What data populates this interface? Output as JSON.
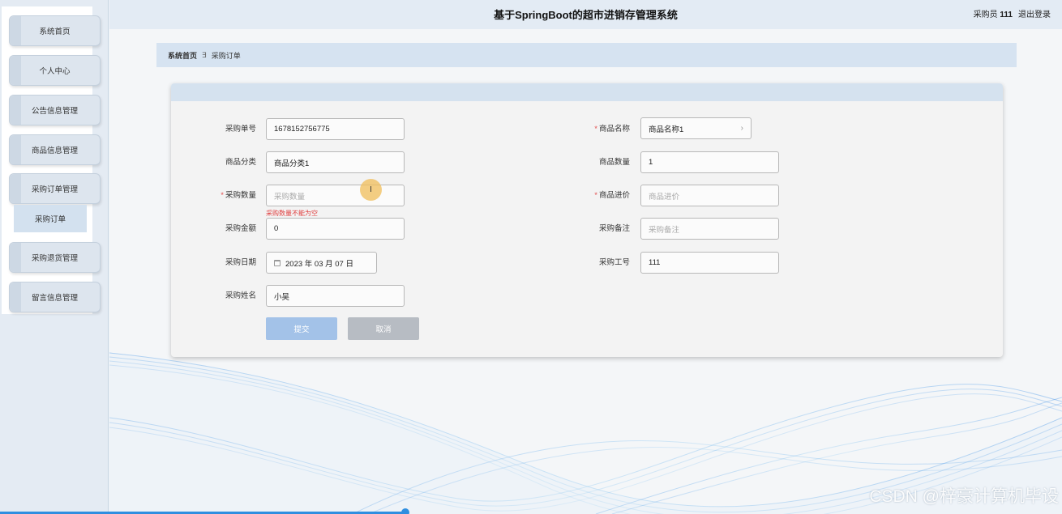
{
  "header": {
    "title": "基于SpringBoot的超市进销存管理系统",
    "user_role": "采购员",
    "user_name": "111",
    "logout": "退出登录"
  },
  "sidebar": {
    "items": [
      {
        "label": "系统首页"
      },
      {
        "label": "个人中心"
      },
      {
        "label": "公告信息管理"
      },
      {
        "label": "商品信息管理"
      },
      {
        "label": "采购订单管理"
      },
      {
        "label": "采购退货管理"
      },
      {
        "label": "留言信息管理"
      }
    ],
    "submenu": {
      "label": "采购订单"
    }
  },
  "breadcrumb": {
    "home": "系统首页",
    "separator": "∃",
    "current": "采购订单"
  },
  "form": {
    "order_no": {
      "label": "采购单号",
      "value": "1678152756775"
    },
    "category": {
      "label": "商品分类",
      "value": "商品分类1"
    },
    "purchase_qty": {
      "label": "采购数量",
      "placeholder": "采购数量",
      "error": "采购数量不能为空"
    },
    "amount": {
      "label": "采购金额",
      "value": "0"
    },
    "date": {
      "label": "采购日期",
      "value": "2023 年 03 月 07 日"
    },
    "buyer_name": {
      "label": "采购姓名",
      "value": "小吴"
    },
    "product_name": {
      "label": "商品名称",
      "value": "商品名称1"
    },
    "product_qty": {
      "label": "商品数量",
      "value": "1"
    },
    "price": {
      "label": "商品进价",
      "placeholder": "商品进价"
    },
    "remark": {
      "label": "采购备注",
      "placeholder": "采购备注"
    },
    "staff_no": {
      "label": "采购工号",
      "value": "111"
    }
  },
  "buttons": {
    "submit": "提交",
    "cancel": "取消"
  },
  "watermark": "CSDN @梓豪计算机毕设",
  "colors": {
    "accent": "#a3c2e8",
    "error": "#e04040",
    "header_bg": "#e3ebf4"
  }
}
